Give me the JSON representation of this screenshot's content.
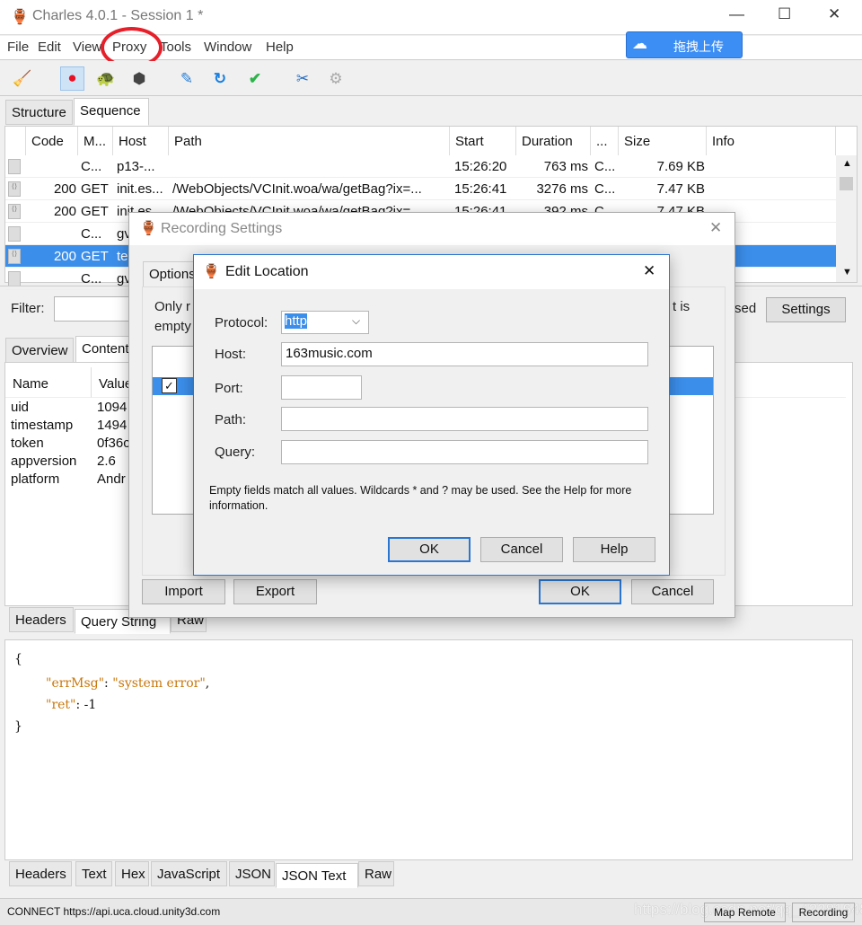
{
  "window": {
    "title": "Charles 4.0.1 - Session 1 *",
    "minimize": "—",
    "maximize": "☐",
    "close": "✕"
  },
  "menu": [
    "File",
    "Edit",
    "View",
    "Proxy",
    "Tools",
    "Window",
    "Help"
  ],
  "upload_button": "拖拽上传",
  "toolbar": [
    "broom-icon",
    "record-icon",
    "throttle-icon",
    "breakpoint-icon",
    "compose-icon",
    "repeat-icon",
    "validate-icon",
    "tools-icon",
    "settings-icon"
  ],
  "view_tabs": [
    "Structure",
    "Sequence"
  ],
  "table": {
    "columns": [
      "Code",
      "M...",
      "Host",
      "Path",
      "Start",
      "Duration",
      "...",
      "Size",
      "Info"
    ],
    "rows": [
      [
        "",
        "C...",
        "p13-...",
        "",
        "15:26:20",
        "763 ms",
        "C...",
        "7.69 KB",
        ""
      ],
      [
        "200",
        "GET",
        "init.es...",
        "/WebObjects/VCInit.woa/wa/getBag?ix=...",
        "15:26:41",
        "3276 ms",
        "C...",
        "7.47 KB",
        ""
      ],
      [
        "200",
        "GET",
        "init.es...",
        "/WebObjects/VCInit.woa/wa/getBag?ix=...",
        "15:26:41",
        "392 ms",
        "C...",
        "7.47 KB",
        ""
      ],
      [
        "",
        "C...",
        "gv",
        "",
        "",
        "",
        "",
        "",
        ""
      ],
      [
        "200",
        "GET",
        "te",
        "",
        "",
        "",
        "",
        "",
        ""
      ],
      [
        "",
        "C...",
        "gv",
        "",
        "",
        "",
        "",
        "",
        ""
      ]
    ]
  },
  "filter": {
    "label": "Filter:",
    "value": "",
    "suffix": "sed",
    "settings": "Settings"
  },
  "detail_tabs": [
    "Overview",
    "Contents"
  ],
  "params": {
    "columns": [
      "Name",
      "Value"
    ],
    "rows": [
      [
        "uid",
        "1094"
      ],
      [
        "timestamp",
        "1494"
      ],
      [
        "token",
        "0f36c"
      ],
      [
        "appversion",
        "2.6"
      ],
      [
        "platform",
        "Andr"
      ]
    ]
  },
  "request_tabs": [
    "Headers",
    "Query String",
    "Raw"
  ],
  "json_text": {
    "open": "{",
    "l1_key": "\"errMsg\"",
    "l1_val": "\"system error\"",
    "l2_key": "\"ret\"",
    "l2_val": "-1",
    "close": "}"
  },
  "response_tabs": [
    "Headers",
    "Text",
    "Hex",
    "JavaScript",
    "JSON",
    "JSON Text",
    "Raw"
  ],
  "status": {
    "text": "CONNECT https://api.uca.cloud.unity3d.com",
    "map_remote": "Map Remote",
    "recording": "Recording",
    "watermark": "https://blog.csdn.net/qq_42281648"
  },
  "recording_dialog": {
    "title": "Recording Settings",
    "tab": "Options",
    "text1": "Only r",
    "text2": "empty",
    "text3": "t is",
    "import": "Import",
    "export": "Export",
    "ok": "OK",
    "cancel": "Cancel"
  },
  "edit_dialog": {
    "title": "Edit Location",
    "protocol_label": "Protocol:",
    "protocol": "http",
    "host_label": "Host:",
    "host": "163music.com",
    "port_label": "Port:",
    "port": "",
    "path_label": "Path:",
    "path": "",
    "query_label": "Query:",
    "query": "",
    "help_text": "Empty fields match all values. Wildcards * and ? may be used. See the Help for more information.",
    "ok": "OK",
    "cancel": "Cancel",
    "help": "Help"
  },
  "colors": {
    "selection": "#3b8eea",
    "annotation": "#e5202a",
    "json_string": "#c8770a"
  }
}
